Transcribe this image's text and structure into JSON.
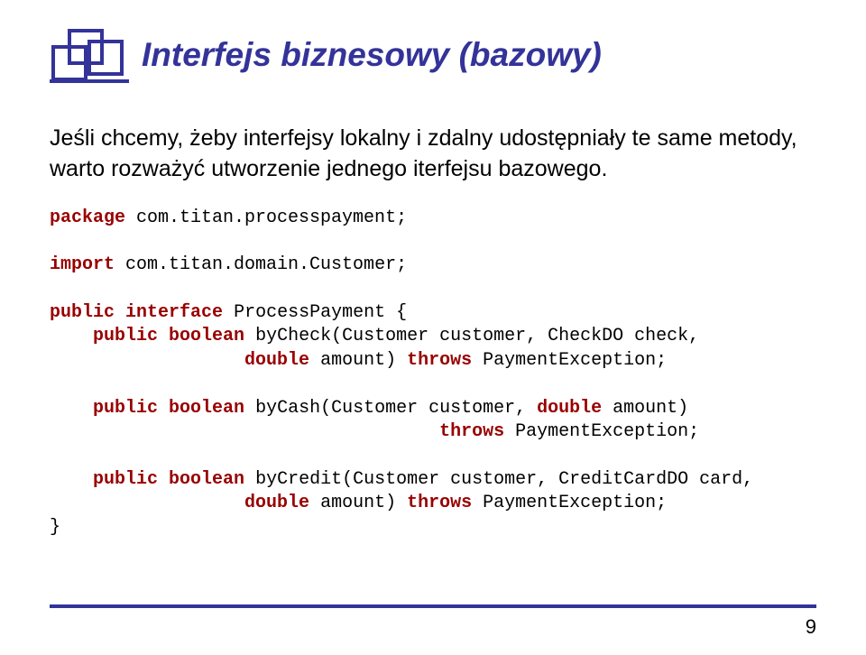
{
  "header": {
    "title": "Interfejs biznesowy (bazowy)"
  },
  "intro": "Jeśli chcemy, żeby interfejsy lokalny i zdalny udostępniały te same metody, warto rozważyć utworzenie jednego iterfejsu bazowego.",
  "code": {
    "kw_package": "package",
    "t1": " com.titan.processpayment;",
    "kw_import": "import",
    "t2": " com.titan.domain.Customer;",
    "kw_public1": "public",
    "kw_interface": "interface",
    "t3": " ProcessPayment {",
    "kw_public2": "public",
    "kw_boolean1": "boolean",
    "t4": " byCheck(Customer customer, CheckDO check,",
    "t5": "                  ",
    "kw_double1": "double",
    "t6": " amount) ",
    "kw_throws1": "throws",
    "t7": " PaymentException;",
    "kw_public3": "public",
    "kw_boolean2": "boolean",
    "t8": " byCash(Customer customer, ",
    "kw_double2": "double",
    "t9": " amount)",
    "t10": "                                    ",
    "kw_throws2": "throws",
    "t11": " PaymentException;",
    "kw_public4": "public",
    "kw_boolean3": "boolean",
    "t12": " byCredit(Customer customer, CreditCardDO card,",
    "t13": "                  ",
    "kw_double3": "double",
    "t14": " amount) ",
    "kw_throws3": "throws",
    "t15": " PaymentException;",
    "t16": "}"
  },
  "page_number": "9"
}
